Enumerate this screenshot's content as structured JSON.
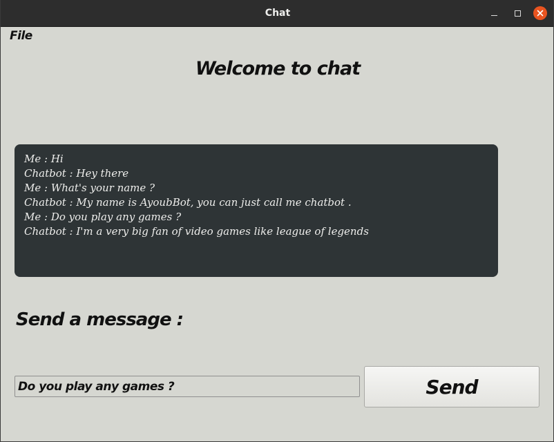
{
  "window": {
    "title": "Chat"
  },
  "menu": {
    "file_label": "File"
  },
  "main": {
    "heading": "Welcome to chat",
    "chat_lines": [
      "Me : Hi",
      "Chatbot : Hey there",
      "Me : What's your name ?",
      "Chatbot : My name is AyoubBot, you can just call me chatbot .",
      "Me : Do you play any games ?",
      "Chatbot : I'm a very big fan of video games like league of legends"
    ],
    "send_label": "Send a message :",
    "input_value": "Do you play any games ?",
    "send_button_label": "Send"
  },
  "colors": {
    "window_bg": "#d6d7d1",
    "titlebar_bg": "#2d2d2d",
    "chat_bg": "#2e3436",
    "close_accent": "#e95420"
  },
  "icons": {
    "minimize": "minimize-icon",
    "maximize": "maximize-icon",
    "close": "close-icon"
  }
}
